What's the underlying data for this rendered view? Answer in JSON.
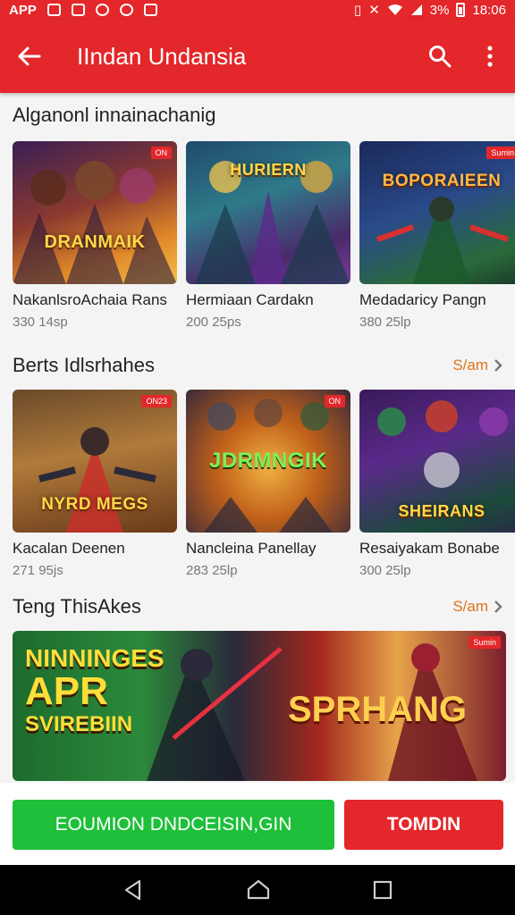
{
  "status_bar": {
    "app_label": "APP",
    "signal": "3%",
    "time": "18:06"
  },
  "app_bar": {
    "title": "IIndan Undansia"
  },
  "section1": {
    "title": "Alganonl innainachanig",
    "items": [
      {
        "name": "NakanlsroAchaia Rans",
        "meta": "330 14sp",
        "badge": "ON",
        "logo": "DRANMAIK"
      },
      {
        "name": "Hermiaan Cardakn",
        "meta": "200 25ps",
        "badge": "",
        "logo": "HURIERN"
      },
      {
        "name": "Medadaricy Pangn",
        "meta": "380 25lp",
        "badge": "Sumin",
        "logo": "BOPORAIEEN"
      }
    ]
  },
  "section2": {
    "title": "Berts Idlsrhahes",
    "see_all": "S/am",
    "items": [
      {
        "name": "Kacalan Deenen",
        "meta": "271 95js",
        "badge": "ON23",
        "logo": "NYRD MEGS"
      },
      {
        "name": "Nancleina Panellay",
        "meta": "283 25lp",
        "badge": "ON",
        "logo": "JDRMNGIK"
      },
      {
        "name": "Resaiyakam Bonabe",
        "meta": "300 25lp",
        "badge": "",
        "logo": "SHEIRANS"
      }
    ]
  },
  "section3": {
    "title": "Teng ThisAkes",
    "see_all": "S/am",
    "banner_badge": "Sumin",
    "banner_left": [
      "NINNINGES",
      "APR",
      "SVIREBIIN"
    ],
    "banner_right": "SPRHANG"
  },
  "actions": {
    "primary": "EOUMION DNDCEISIN,GIN",
    "secondary": "TOMDIN"
  },
  "colors": {
    "brand_red": "#e3272a",
    "install_green": "#1ebf3a",
    "see_all_orange": "#e0741a"
  }
}
